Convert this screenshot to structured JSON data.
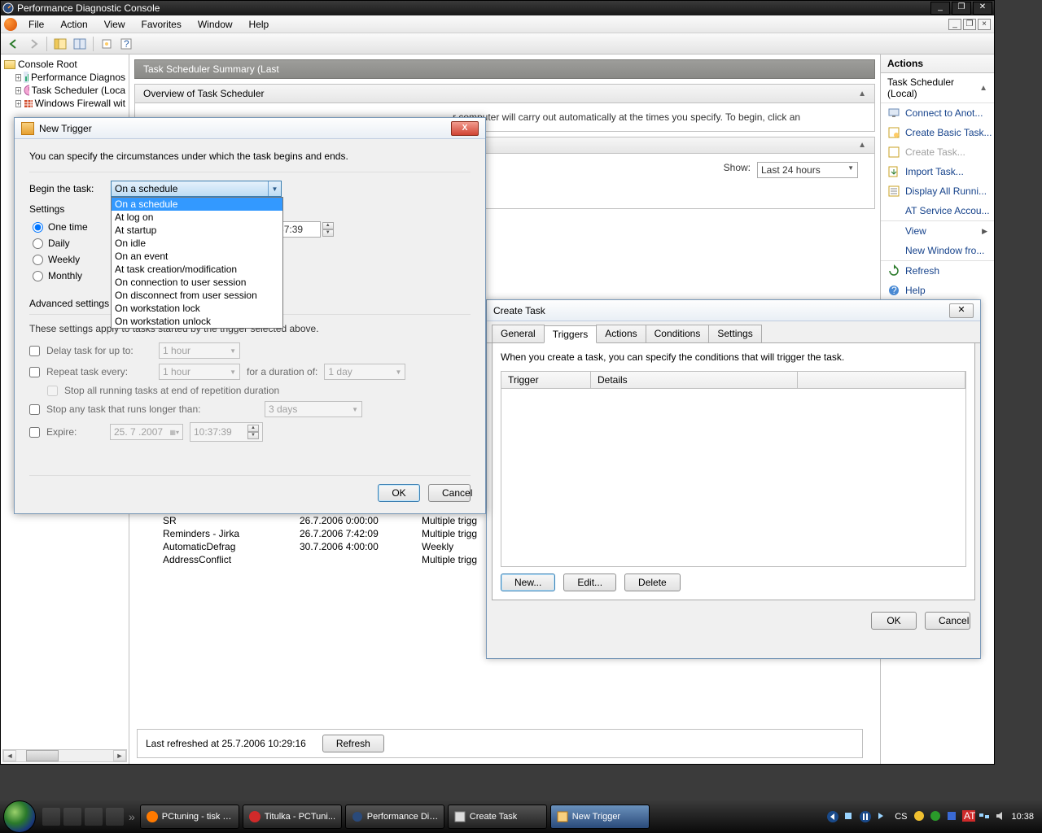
{
  "window": {
    "title": "Performance Diagnostic Console",
    "menus": [
      "File",
      "Action",
      "View",
      "Favorites",
      "Window",
      "Help"
    ]
  },
  "tree": {
    "root": "Console Root",
    "children": [
      "Performance Diagnos",
      "Task Scheduler (Loca",
      "Windows Firewall wit"
    ]
  },
  "center": {
    "summary_header": "Task Scheduler Summary (Last",
    "overview_title": "Overview of Task Scheduler",
    "overview_text": "r computer will carry out automatically at the times you specify. To begin, click an",
    "status": {
      "show_label": "Show:",
      "show_value": "Last 24 hours"
    },
    "tasks": [
      {
        "name": "SR",
        "time": "26.7.2006 0:00:00",
        "trig": "Multiple trigg"
      },
      {
        "name": "Reminders - Jirka",
        "time": "26.7.2006 7:42:09",
        "trig": "Multiple trigg"
      },
      {
        "name": "AutomaticDefrag",
        "time": "30.7.2006 4:00:00",
        "trig": "Weekly"
      },
      {
        "name": "AddressConflict",
        "time": "",
        "trig": "Multiple trigg"
      }
    ],
    "refresh_text": "Last refreshed at 25.7.2006 10:29:16",
    "refresh_btn": "Refresh"
  },
  "actions": {
    "title": "Actions",
    "group": "Task Scheduler (Local)",
    "links": [
      {
        "label": "Connect to Anot...",
        "disabled": false
      },
      {
        "label": "Create Basic Task...",
        "disabled": false
      },
      {
        "label": "Create Task...",
        "disabled": true
      },
      {
        "label": "Import Task...",
        "disabled": false
      },
      {
        "label": "Display All Runni...",
        "disabled": false
      },
      {
        "label": "AT Service Accou...",
        "disabled": false
      },
      {
        "label": "View",
        "disabled": false
      },
      {
        "label": "New Window fro...",
        "disabled": false
      },
      {
        "label": "Refresh",
        "disabled": false
      },
      {
        "label": "Help",
        "disabled": false
      }
    ]
  },
  "create_task": {
    "title": "Create Task",
    "tabs": [
      "General",
      "Triggers",
      "Actions",
      "Conditions",
      "Settings"
    ],
    "active_tab": "Triggers",
    "hint": "When you create a task, you can specify the conditions that will trigger the task.",
    "col1": "Trigger",
    "col2": "Details",
    "new_btn": "New...",
    "edit_btn": "Edit...",
    "delete_btn": "Delete",
    "ok": "OK",
    "cancel": "Cancel"
  },
  "new_trigger": {
    "title": "New Trigger",
    "intro": "You can specify the circumstances under which the task begins and ends.",
    "begin_label": "Begin the task:",
    "begin_value": "On a schedule",
    "begin_options": [
      "On a schedule",
      "At log on",
      "At startup",
      "On idle",
      "On an event",
      "At task creation/modification",
      "On connection to user session",
      "On disconnect from user session",
      "On workstation lock",
      "On workstation unlock"
    ],
    "settings_label": "Settings",
    "radios": [
      "One time",
      "Daily",
      "Weekly",
      "Monthly"
    ],
    "time_value": ":37:39",
    "advanced_title": "Advanced settings",
    "advanced_intro": "These settings apply to tasks started by the trigger selected above.",
    "delay_label": "Delay task for up to:",
    "delay_val": "1 hour",
    "repeat_label": "Repeat task every:",
    "repeat_val": "1 hour",
    "duration_label": "for a duration of:",
    "duration_val": "1 day",
    "stopall_label": "Stop all running tasks at end of repetition duration",
    "stopany_label": "Stop any task that runs longer than:",
    "stopany_val": "3 days",
    "expire_label": "Expire:",
    "expire_date": "25. 7 .2007",
    "expire_time": "10:37:39",
    "ok": "OK",
    "cancel": "Cancel"
  },
  "taskbar": {
    "tasks": [
      "PCtuning - tisk c...",
      "Titulka - PCTuni...",
      "Performance Dia...",
      "Create Task",
      "New Trigger"
    ],
    "lang": "CS",
    "time": "10:38"
  }
}
